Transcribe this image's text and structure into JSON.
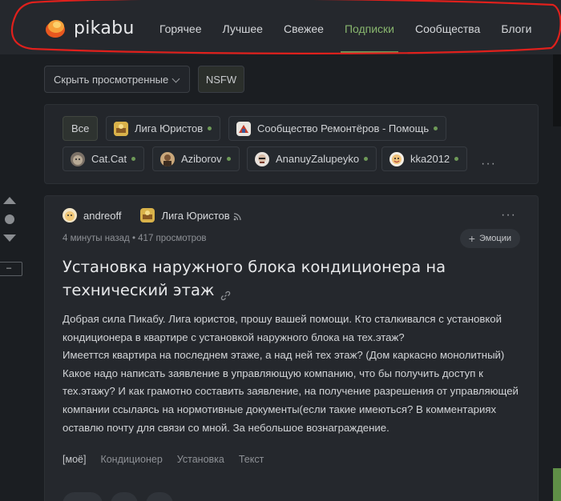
{
  "header": {
    "logo_text": "pikabu",
    "nav": [
      {
        "label": "Горячее",
        "active": false
      },
      {
        "label": "Лучшее",
        "active": false
      },
      {
        "label": "Свежее",
        "active": false
      },
      {
        "label": "Подписки",
        "active": true
      },
      {
        "label": "Сообщества",
        "active": false
      },
      {
        "label": "Блоги",
        "active": false
      }
    ]
  },
  "filters": {
    "select_label": "Скрыть просмотренные",
    "nsfw_label": "NSFW"
  },
  "subscriptions": {
    "all_label": "Все",
    "items": [
      {
        "label": "Лига Юристов"
      },
      {
        "label": "Сообщество Ремонтёров - Помощь"
      },
      {
        "label": "Cat.Cat"
      },
      {
        "label": "Aziborov"
      },
      {
        "label": "AnanuyZalupeyko"
      },
      {
        "label": "kka2012"
      }
    ],
    "more": "···"
  },
  "rail": {
    "minus": "–"
  },
  "post": {
    "author": "andreoff",
    "community": "Лига Юристов",
    "meta": "4 минуты назад • 417 просмотров",
    "emoji_plus": "+",
    "emoji_label": "Эмоции",
    "menu": "···",
    "title": "Установка наружного блока кондиционера на технический этаж",
    "body": [
      "Добрая сила Пикабу. Лига юристов, прошу вашей помощи. Кто сталкивался с установкой кондиционера в квартире с установкой наружного блока на тех.этаж?",
      "Имееттся квартира на последнем этаже, а над ней тех этаж? (Дом каркасно монолитный) Какое надо написать заявление в управляющую компанию, что бы получить доступ к тех.этажу? И как грамотно составить заявление, на получение разрешения от управляющей компании ссылаясь на нормотивные документы(если такие имеються? В комментариях оставлю почту для связи со мной. За небольшое вознаграждение."
    ],
    "tags": [
      {
        "label": "[моё]",
        "mine": true
      },
      {
        "label": "Кондиционер",
        "mine": false
      },
      {
        "label": "Установка",
        "mine": false
      },
      {
        "label": "Текст",
        "mine": false
      }
    ]
  },
  "colors": {
    "background": "#1b1e22",
    "card": "#25282d",
    "accent_green": "#88b66e",
    "annotation_red": "#e0201c"
  }
}
